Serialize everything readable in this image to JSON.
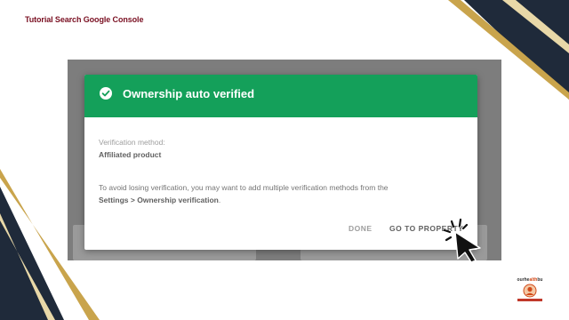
{
  "slide": {
    "title": "Tutorial Search Google Console"
  },
  "dialog": {
    "title": "Ownership auto verified",
    "method_label": "Verification method:",
    "method_value": "Affiliated product",
    "hint_prefix": "To avoid losing verification, you may want to add multiple verification methods from the",
    "hint_link": "Settings > Ownership verification",
    "hint_suffix": ".",
    "done_label": "DONE",
    "go_label": "GO TO PROPERTY"
  },
  "logo": {
    "text_before": "ourhe",
    "text_accent": "alth",
    "text_after": "bu"
  },
  "colors": {
    "header_green": "#14a05a",
    "title_maroon": "#7a1022",
    "gold": "#c9a44c",
    "navy": "#1f2a3a"
  },
  "icons": {
    "header": "check-circle-icon",
    "pointer": "hand-cursor-icon"
  }
}
